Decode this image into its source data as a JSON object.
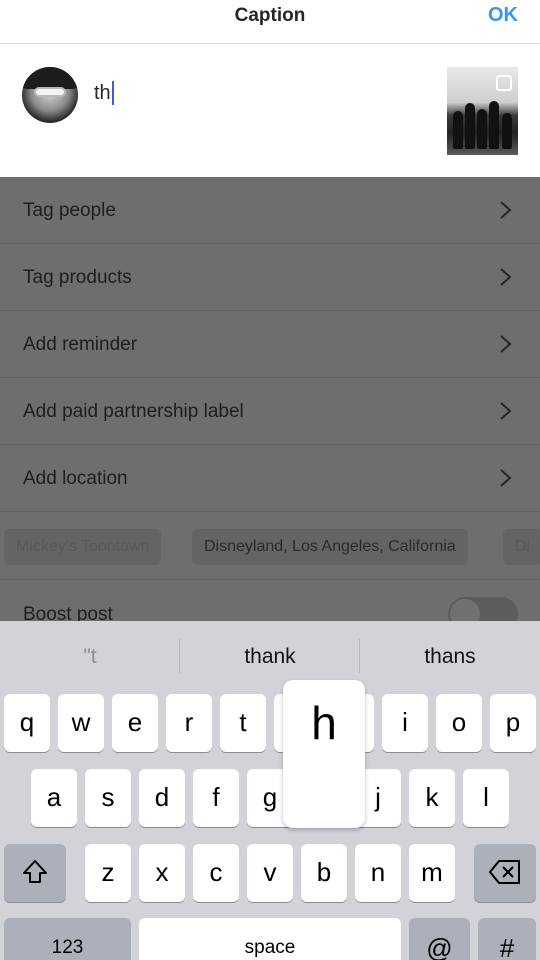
{
  "header": {
    "title": "Caption",
    "ok_label": "OK"
  },
  "caption": {
    "text": "th",
    "avatar_icon": "profile-avatar",
    "thumbnail_icon": "post-thumbnail"
  },
  "options": [
    {
      "label": "Tag people"
    },
    {
      "label": "Tag products"
    },
    {
      "label": "Add reminder"
    },
    {
      "label": "Add paid partnership label"
    },
    {
      "label": "Add location"
    }
  ],
  "location_chips": [
    "Mickey's Toontown",
    "Disneyland, Los Angeles, California",
    "Di"
  ],
  "boost": {
    "label": "Boost post",
    "enabled": false
  },
  "keyboard": {
    "predictions": [
      "\"t",
      "thank",
      "thans"
    ],
    "row1": [
      "q",
      "w",
      "e",
      "r",
      "t",
      "y",
      "u",
      "i",
      "o",
      "p"
    ],
    "row2": [
      "a",
      "s",
      "d",
      "f",
      "g",
      "h",
      "j",
      "k",
      "l"
    ],
    "row3": [
      "z",
      "x",
      "c",
      "v",
      "b",
      "n",
      "m"
    ],
    "row4": {
      "numbers": "123",
      "space": "space",
      "at": "@",
      "hash": "#"
    },
    "popup_letter": "h"
  },
  "colors": {
    "accent": "#3897f0",
    "keyboard_bg": "#d1d3d9",
    "dim_overlay": "#6e6e6e"
  }
}
